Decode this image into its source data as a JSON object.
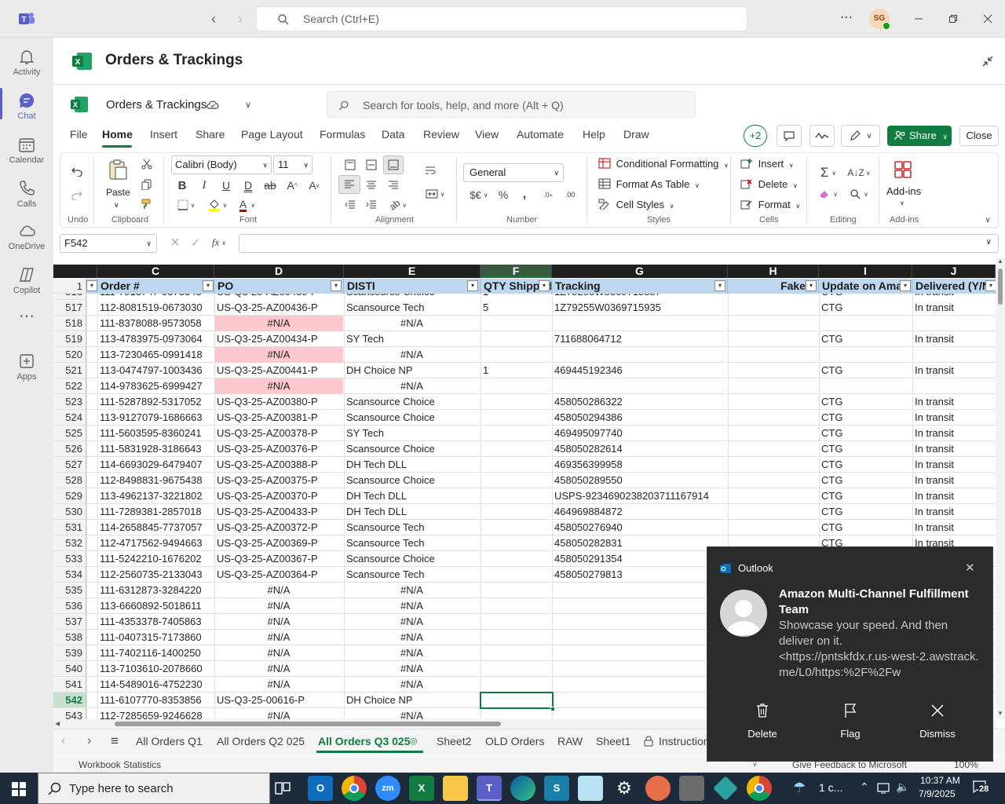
{
  "teams": {
    "search_placeholder": "Search (Ctrl+E)",
    "avatar_initials": "SG",
    "rail": [
      {
        "label": "Activity",
        "icon": "bell-icon"
      },
      {
        "label": "Chat",
        "icon": "chat-icon"
      },
      {
        "label": "Calendar",
        "icon": "calendar-icon"
      },
      {
        "label": "Calls",
        "icon": "phone-icon"
      },
      {
        "label": "OneDrive",
        "icon": "cloud-icon"
      },
      {
        "label": "Copilot",
        "icon": "copilot-icon"
      },
      {
        "label": "",
        "icon": "more-icon"
      },
      {
        "label": "Apps",
        "icon": "apps-icon"
      }
    ]
  },
  "file_title": "Orders & Trackings",
  "excel": {
    "doc_name": "Orders & Trackings",
    "search_placeholder": "Search for tools, help, and more (Alt + Q)",
    "menu": [
      "File",
      "Home",
      "Insert",
      "Share",
      "Page Layout",
      "Formulas",
      "Data",
      "Review",
      "View",
      "Automate",
      "Help",
      "Draw"
    ],
    "active_menu": "Home",
    "collab_count": "+2",
    "share_label": "Share",
    "close_label": "Close",
    "ribbon": {
      "undo_group": "Undo",
      "clipboard_group": "Clipboard",
      "paste_label": "Paste",
      "font_name": "Calibri (Body)",
      "font_size": "11",
      "font_group": "Font",
      "alignment_group": "Alignment",
      "number_format": "General",
      "number_group": "Number",
      "cond_format": "Conditional Formatting",
      "format_table": "Format As Table",
      "cell_styles": "Cell Styles",
      "styles_group": "Styles",
      "insert": "Insert",
      "delete": "Delete",
      "format": "Format",
      "cells_group": "Cells",
      "editing_group": "Editing",
      "addins": "Add-ins",
      "addins_group": "Add-ins"
    },
    "name_box": "F542",
    "fx": "fx",
    "columns": [
      "C",
      "D",
      "E",
      "F",
      "G",
      "H",
      "I",
      "J"
    ],
    "headers": [
      "Order #",
      "PO",
      "DISTI",
      "QTY Shipped",
      "Tracking",
      "Fake",
      "Update on Amaz",
      "Delivered (Y/N"
    ],
    "header_row_num": "1",
    "partial_row": {
      "num": "516",
      "order": "111-7913747-5373343",
      "po": "US-Q3-25-AZ00439-P",
      "disti": "Scansource Choice",
      "qty": "1",
      "tracking": "1Z79255W0369715857",
      "update": "CTG",
      "delivered": "In transit"
    },
    "rows": [
      {
        "num": "517",
        "order": "112-8081519-0673030",
        "po": "US-Q3-25-AZ00436-P",
        "disti": "Scansource Tech",
        "qty": "5",
        "tracking": "1Z79255W0369715935",
        "update": "CTG",
        "delivered": "In transit"
      },
      {
        "num": "518",
        "order": "111-8378088-9573058",
        "po": "#N/A",
        "disti": "#N/A",
        "qty": "",
        "tracking": "",
        "update": "",
        "delivered": "",
        "pink": true
      },
      {
        "num": "519",
        "order": "113-4783975-0973064",
        "po": "US-Q3-25-AZ00434-P",
        "disti": "SY Tech",
        "qty": "",
        "tracking": "711688064712",
        "update": "CTG",
        "delivered": "In transit"
      },
      {
        "num": "520",
        "order": "113-7230465-0991418",
        "po": "#N/A",
        "disti": "#N/A",
        "qty": "",
        "tracking": "",
        "update": "",
        "delivered": "",
        "pink": true
      },
      {
        "num": "521",
        "order": "113-0474797-1003436",
        "po": "US-Q3-25-AZ00441-P",
        "disti": "DH Choice NP",
        "qty": "1",
        "tracking": "469445192346",
        "update": "CTG",
        "delivered": "In transit"
      },
      {
        "num": "522",
        "order": "114-9783625-6999427",
        "po": "#N/A",
        "disti": "#N/A",
        "qty": "",
        "tracking": "",
        "update": "",
        "delivered": "",
        "pink": true
      },
      {
        "num": "523",
        "order": "111-5287892-5317052",
        "po": "US-Q3-25-AZ00380-P",
        "disti": "Scansource Choice",
        "qty": "",
        "tracking": "458050286322",
        "update": "CTG",
        "delivered": "In transit"
      },
      {
        "num": "524",
        "order": "113-9127079-1686663",
        "po": "US-Q3-25-AZ00381-P",
        "disti": "Scansource Choice",
        "qty": "",
        "tracking": "458050294386",
        "update": "CTG",
        "delivered": "In transit"
      },
      {
        "num": "525",
        "order": "111-5603595-8360241",
        "po": "US-Q3-25-AZ00378-P",
        "disti": "SY Tech",
        "qty": "",
        "tracking": "469495097740",
        "update": "CTG",
        "delivered": "In transit"
      },
      {
        "num": "526",
        "order": "111-5831928-3186643",
        "po": "US-Q3-25-AZ00376-P",
        "disti": "Scansource Choice",
        "qty": "",
        "tracking": "458050282614",
        "update": "CTG",
        "delivered": "In transit"
      },
      {
        "num": "527",
        "order": "114-6693029-6479407",
        "po": "US-Q3-25-AZ00388-P",
        "disti": "DH Tech DLL",
        "qty": "",
        "tracking": "469356399958",
        "update": "CTG",
        "delivered": "In transit"
      },
      {
        "num": "528",
        "order": "112-8498831-9675438",
        "po": "US-Q3-25-AZ00375-P",
        "disti": "Scansource Choice",
        "qty": "",
        "tracking": "458050289550",
        "update": "CTG",
        "delivered": "In transit"
      },
      {
        "num": "529",
        "order": "113-4962137-3221802",
        "po": "US-Q3-25-AZ00370-P",
        "disti": "DH Tech DLL",
        "qty": "",
        "tracking": "USPS-9234690238203711167914",
        "update": "CTG",
        "delivered": "In transit"
      },
      {
        "num": "530",
        "order": "111-7289381-2857018",
        "po": "US-Q3-25-AZ00433-P",
        "disti": "DH Tech DLL",
        "qty": "",
        "tracking": "464969884872",
        "update": "CTG",
        "delivered": "In transit"
      },
      {
        "num": "531",
        "order": "114-2658845-7737057",
        "po": "US-Q3-25-AZ00372-P",
        "disti": "Scansource Tech",
        "qty": "",
        "tracking": "458050276940",
        "update": "CTG",
        "delivered": "In transit"
      },
      {
        "num": "532",
        "order": "112-4717562-9494663",
        "po": "US-Q3-25-AZ00369-P",
        "disti": "Scansource Tech",
        "qty": "",
        "tracking": "458050282831",
        "update": "CTG",
        "delivered": "In transit"
      },
      {
        "num": "533",
        "order": "111-5242210-1676202",
        "po": "US-Q3-25-AZ00367-P",
        "disti": "Scansource Choice",
        "qty": "",
        "tracking": "458050291354",
        "update": "",
        "delivered": ""
      },
      {
        "num": "534",
        "order": "112-2560735-2133043",
        "po": "US-Q3-25-AZ00364-P",
        "disti": "Scansource Tech",
        "qty": "",
        "tracking": "458050279813",
        "update": "",
        "delivered": ""
      },
      {
        "num": "535",
        "order": "111-6312873-3284220",
        "po": "#N/A",
        "disti": "#N/A",
        "qty": "",
        "tracking": "",
        "update": "",
        "delivered": ""
      },
      {
        "num": "536",
        "order": "113-6660892-5018611",
        "po": "#N/A",
        "disti": "#N/A",
        "qty": "",
        "tracking": "",
        "update": "",
        "delivered": ""
      },
      {
        "num": "537",
        "order": "111-4353378-7405863",
        "po": "#N/A",
        "disti": "#N/A",
        "qty": "",
        "tracking": "",
        "update": "",
        "delivered": ""
      },
      {
        "num": "538",
        "order": "111-0407315-7173860",
        "po": "#N/A",
        "disti": "#N/A",
        "qty": "",
        "tracking": "",
        "update": "",
        "delivered": ""
      },
      {
        "num": "539",
        "order": "111-7402116-1400250",
        "po": "#N/A",
        "disti": "#N/A",
        "qty": "",
        "tracking": "",
        "update": "",
        "delivered": ""
      },
      {
        "num": "540",
        "order": "113-7103610-2078660",
        "po": "#N/A",
        "disti": "#N/A",
        "qty": "",
        "tracking": "",
        "update": "",
        "delivered": ""
      },
      {
        "num": "541",
        "order": "114-5489016-4752230",
        "po": "#N/A",
        "disti": "#N/A",
        "qty": "",
        "tracking": "",
        "update": "",
        "delivered": ""
      },
      {
        "num": "542",
        "order": "111-6107770-8353856",
        "po": "US-Q3-25-00616-P",
        "disti": "DH Choice NP",
        "qty": "",
        "tracking": "",
        "update": "",
        "delivered": "",
        "active": true
      },
      {
        "num": "543",
        "order": "112-7285659-9246628",
        "po": "#N/A",
        "disti": "#N/A",
        "qty": "",
        "tracking": "",
        "update": "",
        "delivered": ""
      }
    ],
    "sheets": [
      "All Orders Q1",
      "All Orders Q2 025",
      "All Orders Q3 025",
      "Sheet2",
      "OLD Orders",
      "RAW",
      "Sheet1",
      "Instruction"
    ],
    "active_sheet": "All Orders Q3 025",
    "status_left": "Workbook Statistics",
    "status_feedback": "Give Feedback to Microsoft",
    "status_zoom": "100%"
  },
  "toast": {
    "app": "Outlook",
    "sender": "Amazon Multi-Channel Fulfillment Team",
    "line1": "Showcase your speed. And then deliver on it.",
    "line2": "<https://pntskfdx.r.us-west-2.awstrack.me/L0/https:%2F%2Fw",
    "actions": [
      "Delete",
      "Flag",
      "Dismiss"
    ]
  },
  "taskbar": {
    "search_placeholder": "Type here to search",
    "weather": "1 c...",
    "time": "10:37 AM",
    "date": "7/9/2025",
    "notif_count": "28"
  },
  "colors": {
    "excel_green": "#107c41",
    "teams_purple": "#5b5fc7",
    "header_fill": "#bdd7ee",
    "na_pink": "#ffc7ce"
  }
}
